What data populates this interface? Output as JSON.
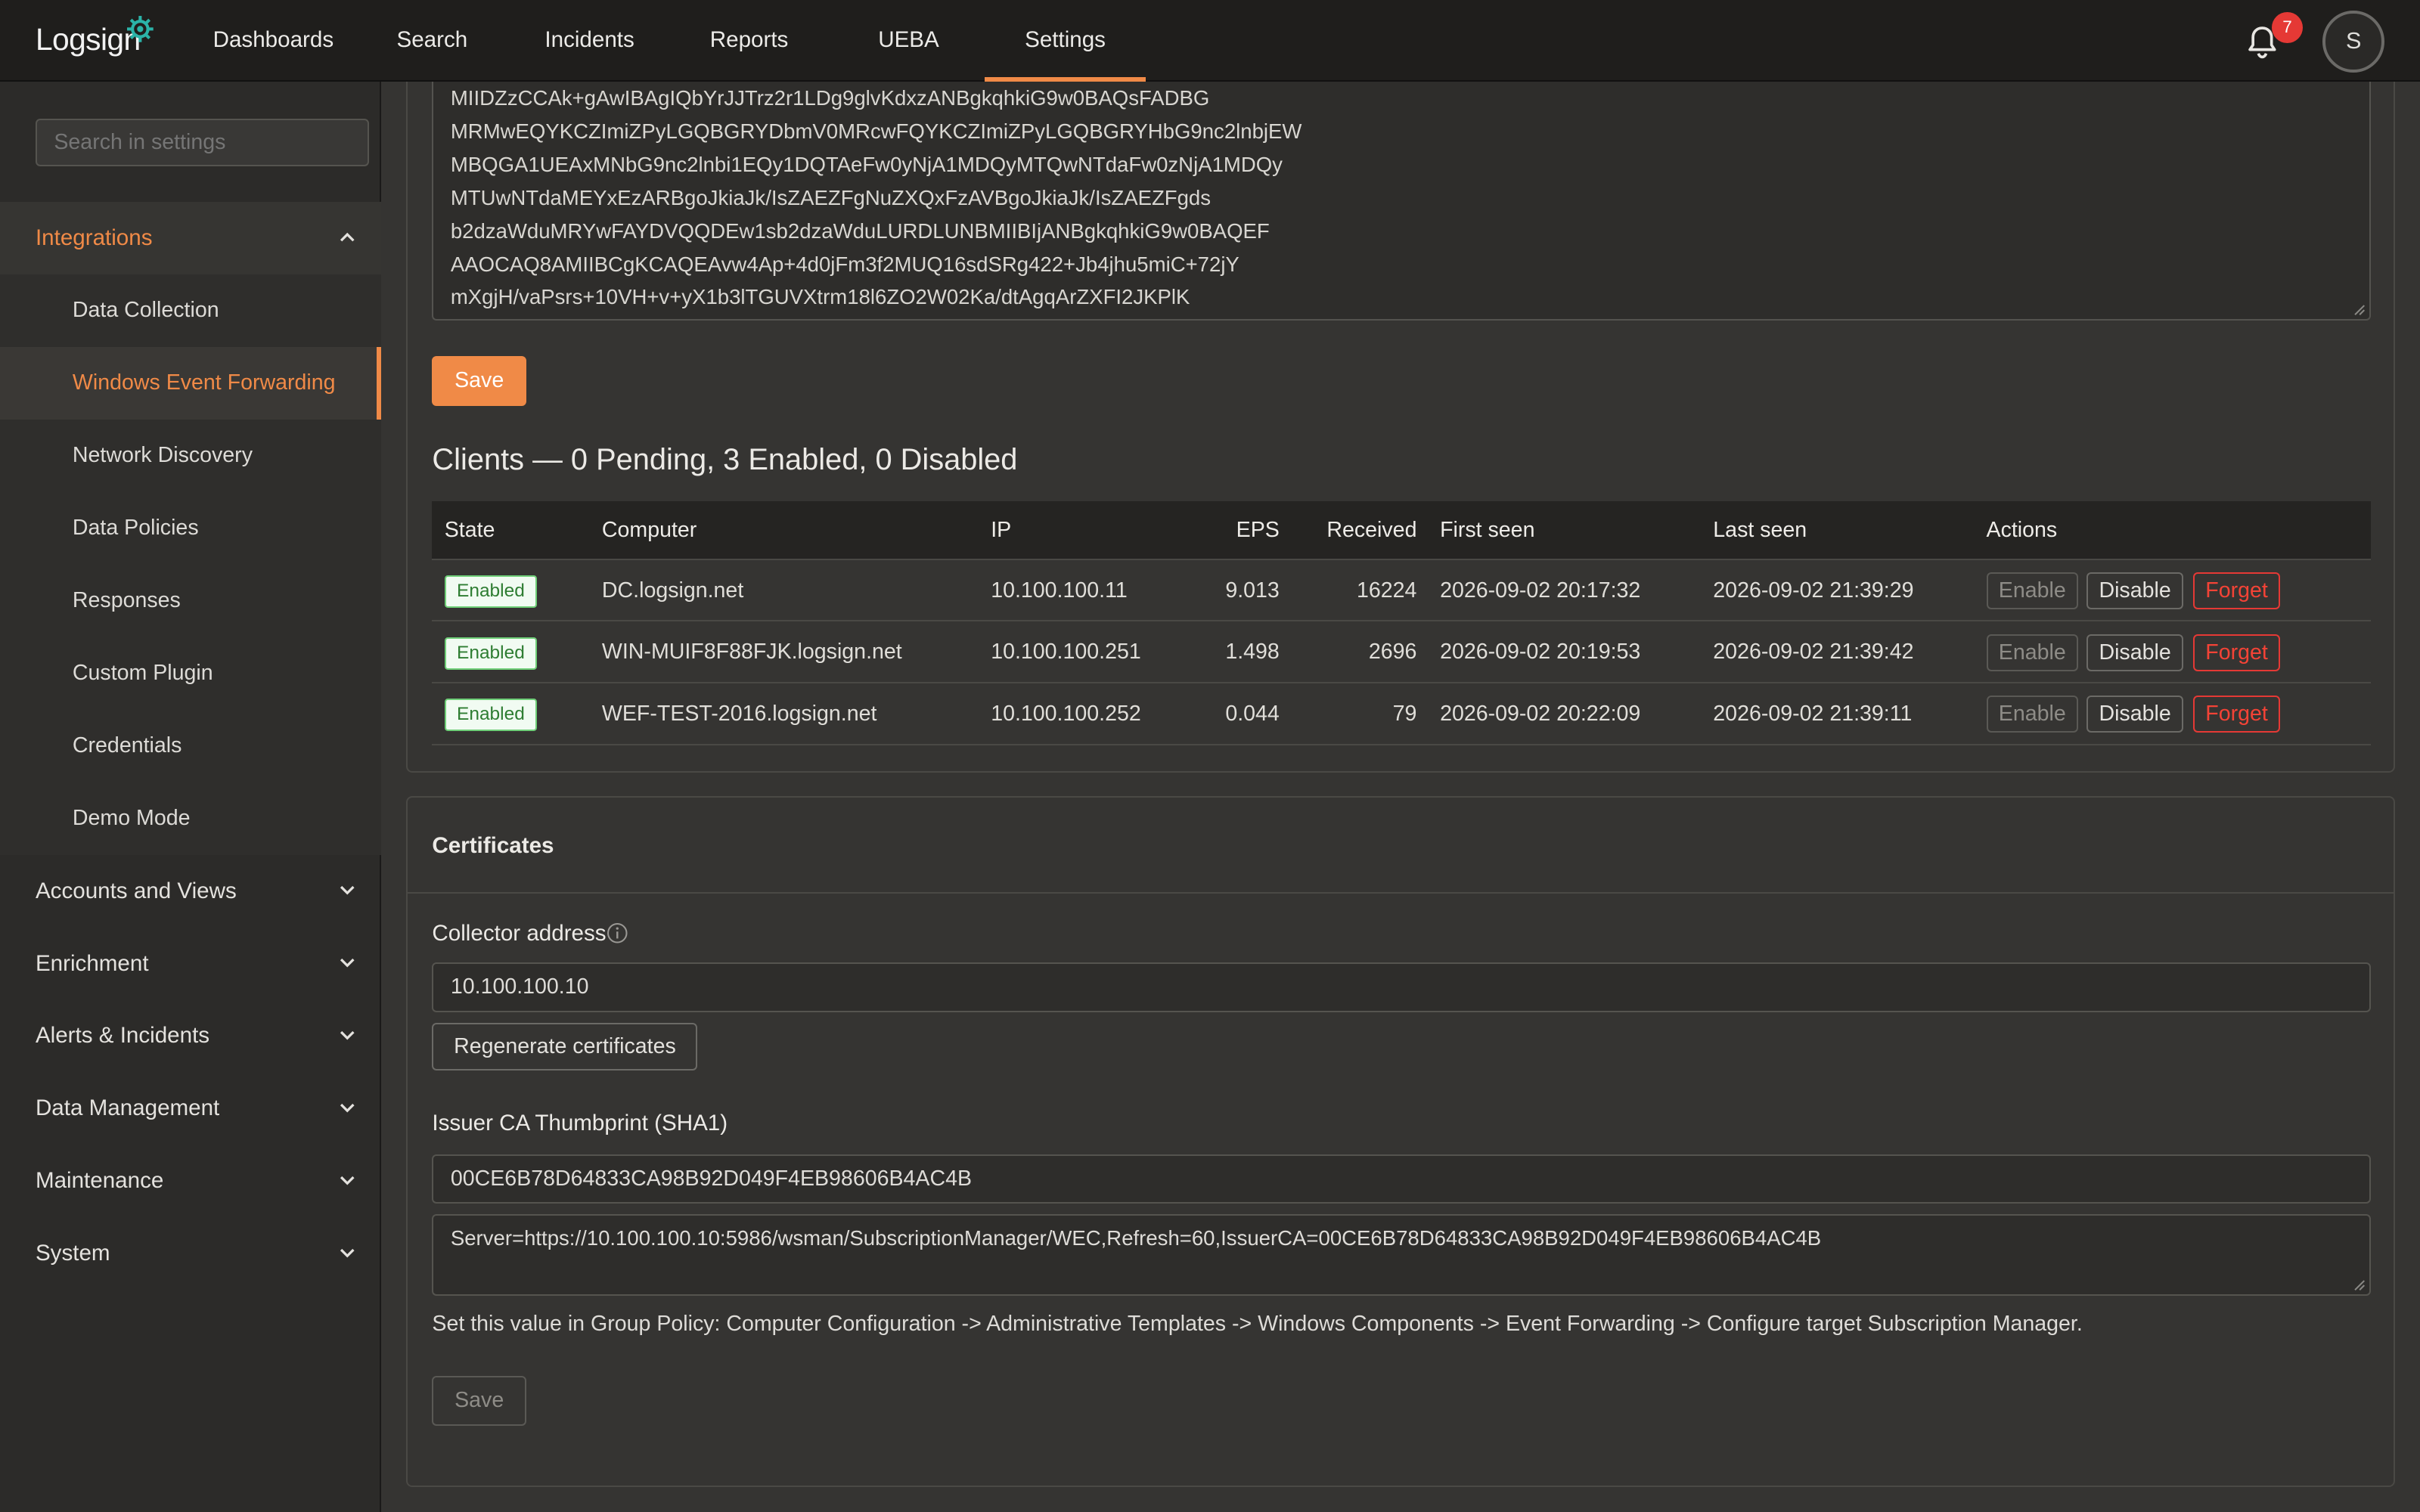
{
  "app": {
    "logo_text": "Logsign",
    "notifications_count": "7",
    "avatar_initial": "S"
  },
  "nav": {
    "items": [
      "Dashboards",
      "Search",
      "Incidents",
      "Reports",
      "UEBA",
      "Settings"
    ],
    "active": "Settings"
  },
  "sidebar": {
    "search_placeholder": "Search in settings",
    "integrations_label": "Integrations",
    "sub_items": [
      "Data Collection",
      "Windows Event Forwarding",
      "Network Discovery",
      "Data Policies",
      "Responses",
      "Custom Plugin",
      "Credentials",
      "Demo Mode"
    ],
    "active_sub": "Windows Event Forwarding",
    "sections": [
      "Accounts and Views",
      "Enrichment",
      "Alerts & Incidents",
      "Data Management",
      "Maintenance",
      "System"
    ]
  },
  "cert_text": {
    "lines": [
      "MIIDZzCCAk+gAwIBAgIQbYrJJTrz2r1LDg9glvKdxzANBgkqhkiG9w0BAQsFADBG",
      "MRMwEQYKCZImiZPyLGQBGRYDbmV0MRcwFQYKCZImiZPyLGQBGRYHbG9nc2lnbjEW",
      "MBQGA1UEAxMNbG9nc2lnbi1EQy1DQTAeFw0yNjA1MDQyMTQwNTdaFw0zNjA1MDQy",
      "MTUwNTdaMEYxEzARBgoJkiaJk/IsZAEZFgNuZXQxFzAVBgoJkiaJk/IsZAEZFgds",
      "b2dzaWduMRYwFAYDVQQDEw1sb2dzaWduLURDLUNBMIIBIjANBgkqhkiG9w0BAQEF",
      "AAOCAQ8AMIIBCgKCAQEAvw4Ap+4d0jFm3f2MUQ16sdSRg422+Jb4jhu5miC+72jY",
      "mXgjH/vaPsrs+10VH+v+yX1b3lTGUVXtrm18l6ZO2W02Ka/dtAgqArZXFI2JKPlK"
    ]
  },
  "save_label": "Save",
  "clients": {
    "title": "Clients — 0 Pending, 3 Enabled, 0 Disabled",
    "columns": [
      "State",
      "Computer",
      "IP",
      "EPS",
      "Received",
      "First seen",
      "Last seen",
      "Actions"
    ],
    "rows": [
      {
        "state": "Enabled",
        "computer": "DC.logsign.net",
        "ip": "10.100.100.11",
        "eps": "9.013",
        "received": "16224",
        "first_seen": "2026-09-02 20:17:32",
        "last_seen": "2026-09-02 21:39:29"
      },
      {
        "state": "Enabled",
        "computer": "WIN-MUIF8F88FJK.logsign.net",
        "ip": "10.100.100.251",
        "eps": "1.498",
        "received": "2696",
        "first_seen": "2026-09-02 20:19:53",
        "last_seen": "2026-09-02 21:39:42"
      },
      {
        "state": "Enabled",
        "computer": "WEF-TEST-2016.logsign.net",
        "ip": "10.100.100.252",
        "eps": "0.044",
        "received": "79",
        "first_seen": "2026-09-02 20:22:09",
        "last_seen": "2026-09-02 21:39:11"
      }
    ],
    "actions": {
      "enable": "Enable",
      "disable": "Disable",
      "forget": "Forget"
    }
  },
  "certificates": {
    "title": "Certificates",
    "collector_label": "Collector address",
    "collector_value": "10.100.100.10",
    "regen_label": "Regenerate certificates",
    "thumbprint_label": "Issuer CA Thumbprint (SHA1)",
    "thumbprint_value": "00CE6B78D64833CA98B92D049F4EB98606B4AC4B",
    "server_value": "Server=https://10.100.100.10:5986/wsman/SubscriptionManager/WEC,Refresh=60,IssuerCA=00CE6B78D64833CA98B92D049F4EB98606B4AC4B",
    "hint": "Set this value in Group Policy: Computer Configuration -> Administrative Templates -> Windows Components -> Event Forwarding -> Configure target Subscription Manager.",
    "save_label": "Save"
  },
  "colors": {
    "accent": "#f08a47",
    "enabled_badge": "#2e7d32",
    "danger": "#e53935"
  }
}
